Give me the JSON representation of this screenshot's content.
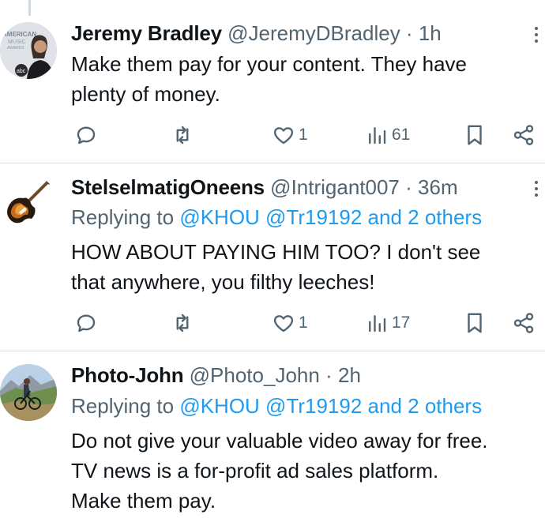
{
  "tweets": [
    {
      "name": "Jeremy Bradley",
      "handle": "@JeremyDBradley",
      "time": "1h",
      "avatar_text": "AMERICAN MUSIC AWARDS abc",
      "replying_to": null,
      "text_lines": [
        "Make them pay for your content. They have",
        "plenty of money."
      ],
      "likes": "1",
      "views": "61",
      "icons": [
        "reply-icon",
        "retweet-icon",
        "like-icon",
        "views-icon",
        "bookmark-icon",
        "share-icon"
      ]
    },
    {
      "name": "StelselmatigOneens",
      "handle": "@Intrigant007",
      "time": "36m",
      "replying_to": {
        "prefix": "Replying to",
        "mentions": "@KHOU @Tr19192 and 2 others"
      },
      "text_lines": [
        "HOW ABOUT PAYING HIM TOO? I don't see",
        "that anywhere, you filthy leeches!"
      ],
      "likes": "1",
      "views": "17"
    },
    {
      "name": "Photo-John",
      "handle": "@Photo_John",
      "time": "2h",
      "replying_to": {
        "prefix": "Replying to",
        "mentions": "@KHOU @Tr19192 and 2 others"
      },
      "text_lines": [
        "Do not give your valuable video away for free.",
        "TV news is a for-profit ad sales platform.",
        "Make them pay."
      ]
    }
  ],
  "separator": "·",
  "colors": {
    "text": "#0f1419",
    "muted": "#536471",
    "link": "#1d9bf0",
    "divider": "#d9dee2"
  }
}
